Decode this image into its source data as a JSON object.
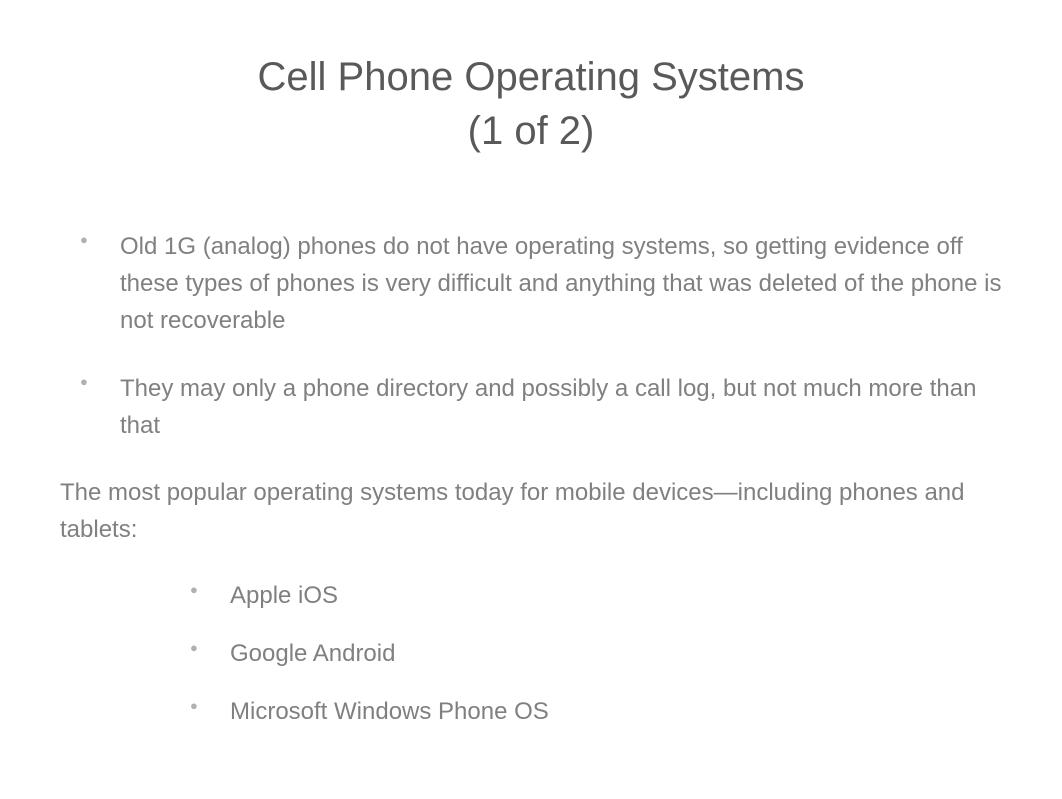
{
  "title_line1": "Cell Phone Operating Systems",
  "title_line2": "(1 of 2)",
  "bullets": [
    "Old 1G (analog) phones do not have operating systems, so getting evidence off these types of phones is very difficult and anything that was deleted of the phone is not recoverable",
    "They may only a phone directory and possibly a call log, but not much more than that"
  ],
  "intro": "The most popular operating systems today for mobile devices—including phones and tablets:",
  "sublist": [
    "Apple iOS",
    "Google Android",
    "Microsoft Windows Phone OS"
  ]
}
